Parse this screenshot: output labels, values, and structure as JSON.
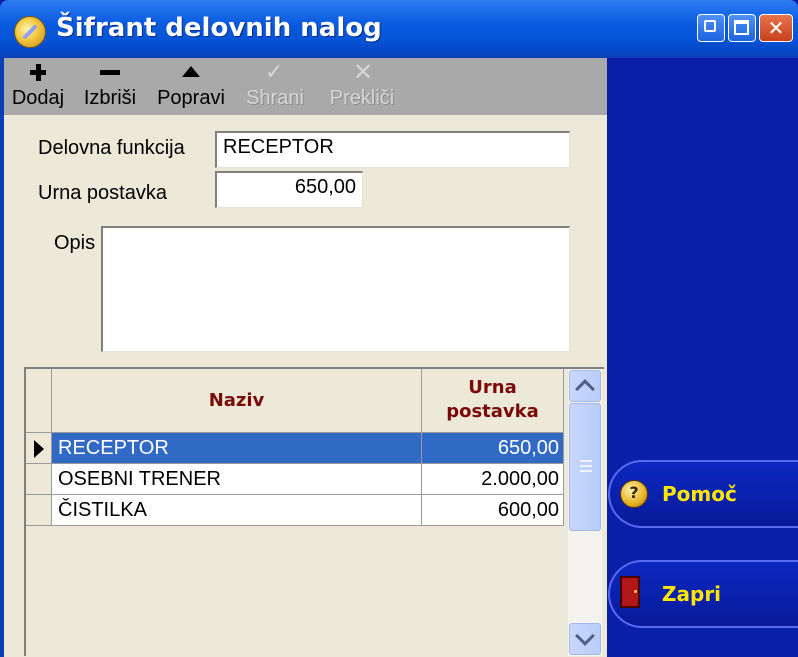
{
  "window": {
    "title": "Šifrant delovnih nalog"
  },
  "toolbar": {
    "items": [
      {
        "label": "Dodaj",
        "icon": "plus-icon",
        "enabled": true
      },
      {
        "label": "Izbriši",
        "icon": "minus-icon",
        "enabled": true
      },
      {
        "label": "Popravi",
        "icon": "triangle-up-icon",
        "enabled": true
      },
      {
        "label": "Shrani",
        "icon": "check-icon",
        "enabled": false
      },
      {
        "label": "Prekliči",
        "icon": "x-icon",
        "enabled": false
      }
    ]
  },
  "form": {
    "delovna_funkcija": {
      "label": "Delovna funkcija",
      "value": "RECEPTOR"
    },
    "urna_postavka": {
      "label": "Urna postavka",
      "value": "650,00"
    },
    "opis": {
      "label": "Opis",
      "value": ""
    }
  },
  "grid": {
    "columns": {
      "naziv": "Naziv",
      "urna_line1": "Urna",
      "urna_line2": "postavka"
    },
    "rows": [
      {
        "naziv": "RECEPTOR",
        "urna": "650,00",
        "selected": true
      },
      {
        "naziv": "OSEBNI TRENER",
        "urna": "2.000,00",
        "selected": false
      },
      {
        "naziv": "ČISTILKA",
        "urna": "600,00",
        "selected": false
      }
    ]
  },
  "sidebar": {
    "help_label": "Pomoč",
    "close_label": "Zapri"
  },
  "colors": {
    "title_bar": "#0653d6",
    "side_panel": "#0a1fa8",
    "selection": "#316ac5",
    "header_text": "#7a0a0a",
    "side_button_text": "#ffe600",
    "toolbar": "#a9a9a9"
  }
}
